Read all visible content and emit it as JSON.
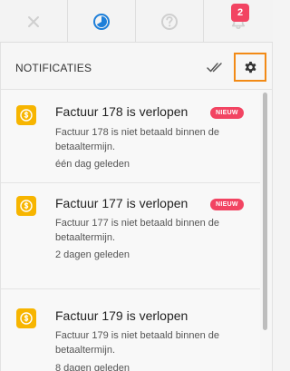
{
  "toolbar": {
    "buttons": [
      {
        "icon": "close-icon"
      },
      {
        "icon": "timer-icon"
      },
      {
        "icon": "help-icon"
      },
      {
        "icon": "bell-icon",
        "badge": "2"
      }
    ],
    "active_color": "#1e7fd9",
    "inactive_color": "#d0d0d0"
  },
  "panel": {
    "title": "NOTIFICATIES",
    "mark_all_icon": "double-check-icon",
    "settings_icon": "gear-icon",
    "settings_highlight_color": "#f28a16"
  },
  "notifications": [
    {
      "icon": "dollar-icon",
      "title": "Factuur 178 is verlopen",
      "badge": "NIEUW",
      "description": "Factuur 178 is niet betaald binnen de betaaltermijn.",
      "time": "één dag geleden"
    },
    {
      "icon": "dollar-icon",
      "title": "Factuur 177 is verlopen",
      "badge": "NIEUW",
      "description": "Factuur 177 is niet betaald binnen de betaaltermijn.",
      "time": "2 dagen geleden"
    },
    {
      "icon": "dollar-icon",
      "title": "Factuur 179 is verlopen",
      "badge": "",
      "description": "Factuur 179 is niet betaald binnen de betaaltermijn.",
      "time": "8 dagen geleden"
    }
  ],
  "colors": {
    "new_badge": "#f24462",
    "invoice_icon": "#f7b500"
  }
}
